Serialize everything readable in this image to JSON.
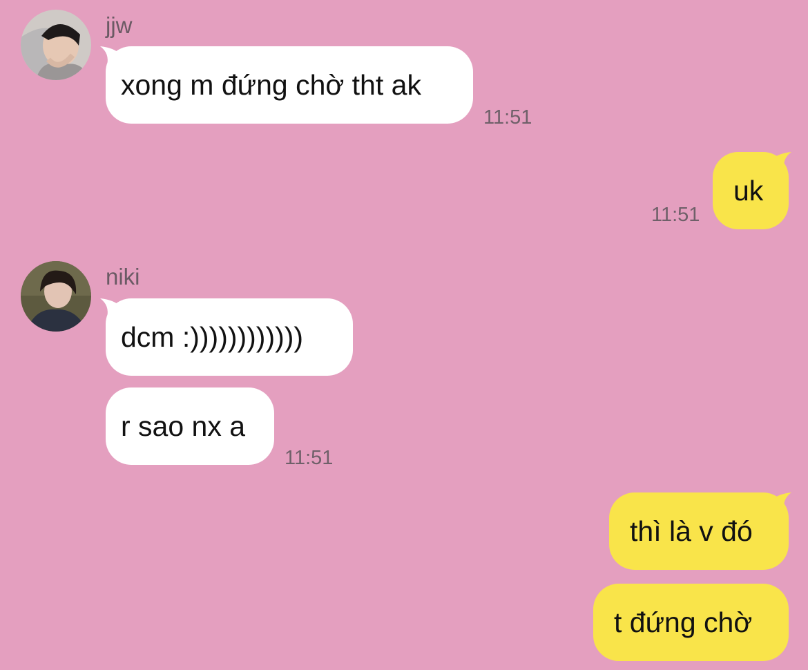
{
  "theme": {
    "background": "#e49fbf",
    "incoming_bubble": "#ffffff",
    "outgoing_bubble": "#f9e44a"
  },
  "messages": [
    {
      "direction": "incoming",
      "sender": "jjw",
      "avatar_icon": "avatar-photo-jjw",
      "text": "xong m đứng chờ tht ak",
      "time": "11:51"
    },
    {
      "direction": "outgoing",
      "text": "uk",
      "time": "11:51"
    },
    {
      "direction": "incoming",
      "sender": "niki",
      "avatar_icon": "avatar-photo-niki",
      "text": "dcm :))))))))))))"
    },
    {
      "direction": "incoming",
      "text": "r sao nx a",
      "time": "11:51"
    },
    {
      "direction": "outgoing",
      "text": "thì là v đó"
    },
    {
      "direction": "outgoing",
      "text": "t đứng chờ"
    }
  ]
}
